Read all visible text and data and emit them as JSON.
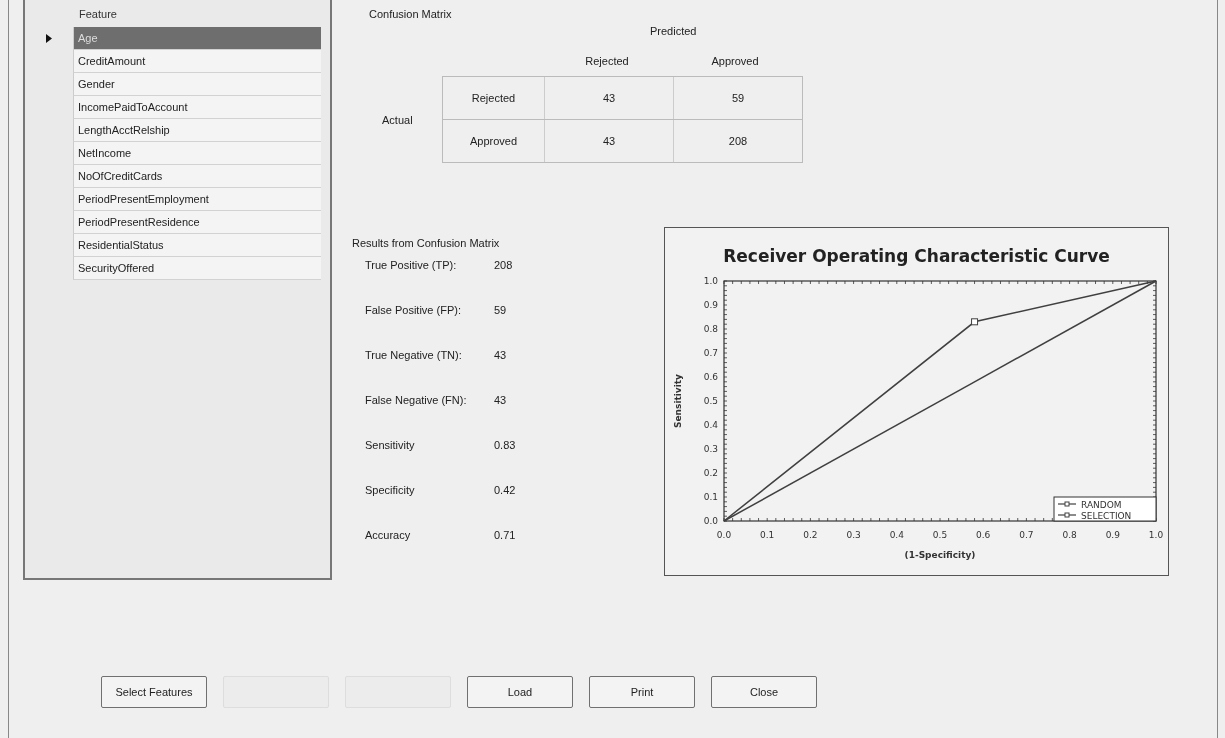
{
  "feature_grid": {
    "column": "Feature",
    "rows": [
      {
        "label": "Age",
        "selected": true
      },
      {
        "label": "CreditAmount",
        "selected": false
      },
      {
        "label": "Gender",
        "selected": false
      },
      {
        "label": "IncomePaidToAccount",
        "selected": false
      },
      {
        "label": "LengthAcctRelship",
        "selected": false
      },
      {
        "label": "NetIncome",
        "selected": false
      },
      {
        "label": "NoOfCreditCards",
        "selected": false
      },
      {
        "label": "PeriodPresentEmployment",
        "selected": false
      },
      {
        "label": "PeriodPresentResidence",
        "selected": false
      },
      {
        "label": "ResidentialStatus",
        "selected": false
      },
      {
        "label": "SecurityOffered",
        "selected": false
      }
    ]
  },
  "confusion_matrix": {
    "title": "Confusion Matrix",
    "predicted_label": "Predicted",
    "actual_label": "Actual",
    "columns": [
      "Rejected",
      "Approved"
    ],
    "rows": [
      {
        "label": "Rejected",
        "cells": [
          "43",
          "59"
        ]
      },
      {
        "label": "Approved",
        "cells": [
          "43",
          "208"
        ]
      }
    ]
  },
  "results": {
    "title": "Results from Confusion Matrix",
    "items": [
      {
        "label": "True Positive (TP):",
        "value": "208"
      },
      {
        "label": "False Positive (FP):",
        "value": "59"
      },
      {
        "label": "True Negative (TN):",
        "value": "43"
      },
      {
        "label": "False Negative (FN):",
        "value": "43"
      },
      {
        "label": "Sensitivity",
        "value": "0.83"
      },
      {
        "label": "Specificity",
        "value": "0.42"
      },
      {
        "label": "Accuracy",
        "value": "0.71"
      }
    ]
  },
  "roc_chart": {
    "chart_data": {
      "type": "line",
      "title": "Receiver Operating Characteristic Curve",
      "xlabel": "(1-Specificity)",
      "ylabel": "Sensitivity",
      "x": [
        0,
        0.58,
        1
      ],
      "series": [
        {
          "name": "RANDOM",
          "color": "#404040",
          "values": [
            0,
            0.58,
            1
          ]
        },
        {
          "name": "SELECTION",
          "color": "#404040",
          "values": [
            0,
            0.83,
            1
          ]
        }
      ],
      "xlim": [
        0,
        1
      ],
      "ylim": [
        0,
        1
      ],
      "legend": "lower right",
      "xticks": [
        {
          "value": 0,
          "label": "0.0"
        },
        {
          "value": 0.1,
          "label": "0.1"
        },
        {
          "value": 0.2,
          "label": "0.2"
        },
        {
          "value": 0.3,
          "label": "0.3"
        },
        {
          "value": 0.4,
          "label": "0.4"
        },
        {
          "value": 0.5,
          "label": "0.5"
        },
        {
          "value": 0.6,
          "label": "0.6"
        },
        {
          "value": 0.7,
          "label": "0.7"
        },
        {
          "value": 0.8,
          "label": "0.8"
        },
        {
          "value": 0.9,
          "label": "0.9"
        },
        {
          "value": 1,
          "label": "1.0"
        }
      ],
      "yticks": [
        {
          "value": 0,
          "label": "0.0"
        },
        {
          "value": 0.1,
          "label": "0.1"
        },
        {
          "value": 0.2,
          "label": "0.2"
        },
        {
          "value": 0.3,
          "label": "0.3"
        },
        {
          "value": 0.4,
          "label": "0.4"
        },
        {
          "value": 0.5,
          "label": "0.5"
        },
        {
          "value": 0.6,
          "label": "0.6"
        },
        {
          "value": 0.7,
          "label": "0.7"
        },
        {
          "value": 0.8,
          "label": "0.8"
        },
        {
          "value": 0.9,
          "label": "0.9"
        },
        {
          "value": 1,
          "label": "1.0"
        }
      ]
    }
  },
  "buttons": [
    {
      "label": "Select Features",
      "disabled": false
    },
    {
      "disabled": true
    },
    {
      "disabled": true
    },
    {
      "label": "Load",
      "disabled": false
    },
    {
      "label": "Print",
      "disabled": false
    },
    {
      "label": "Close",
      "disabled": false
    }
  ]
}
